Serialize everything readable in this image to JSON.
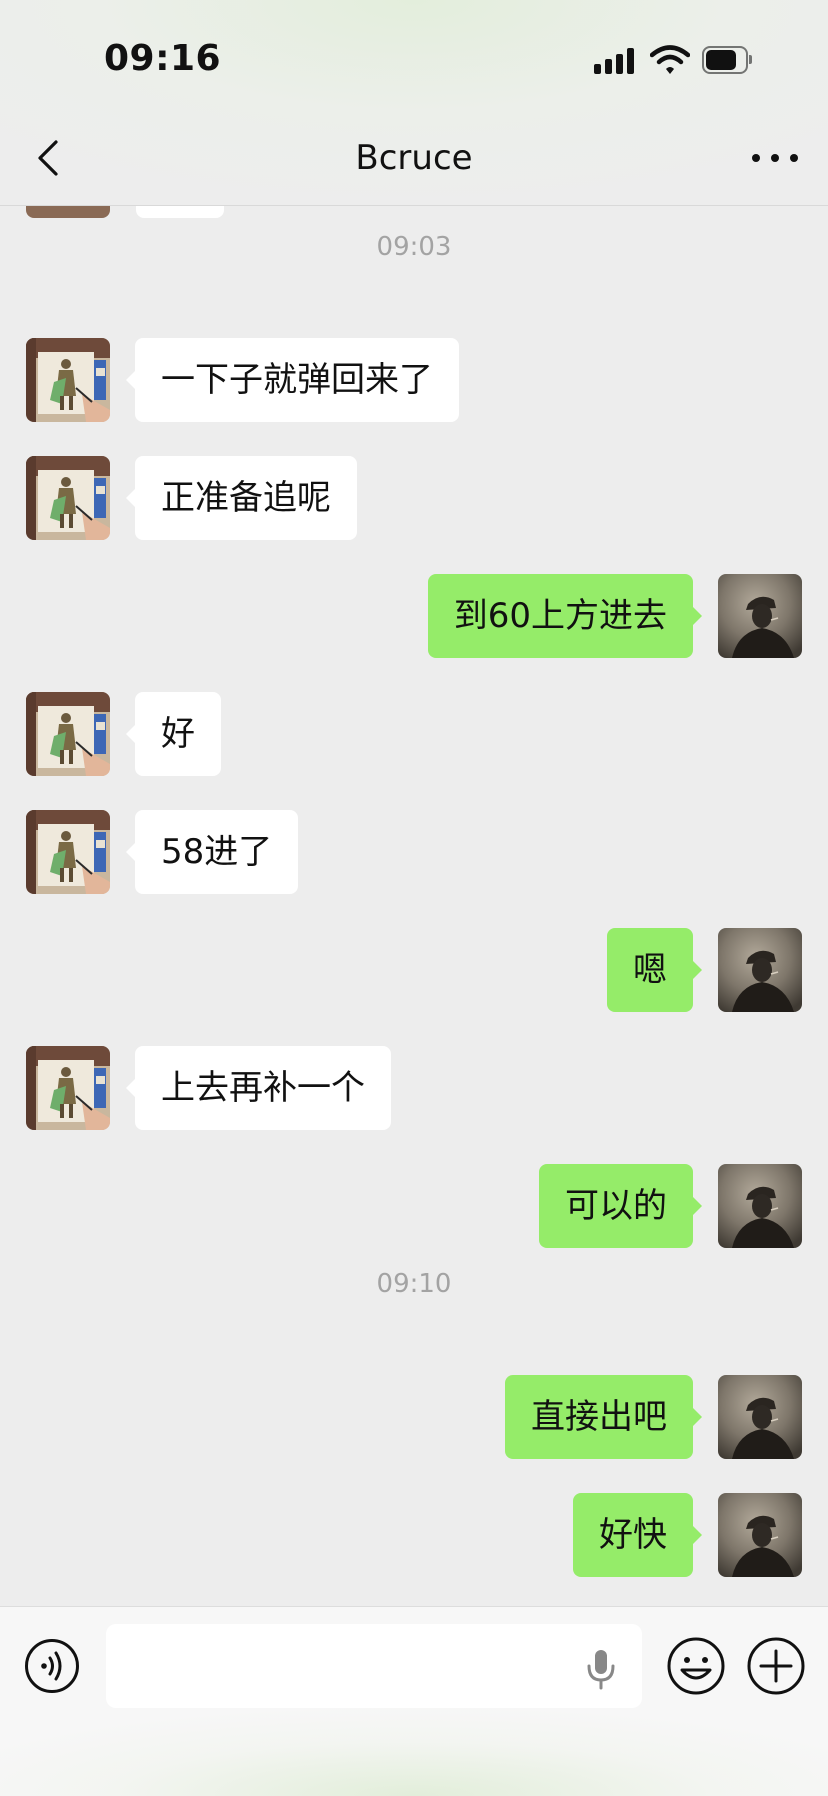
{
  "status_bar": {
    "time": "09:16",
    "icons": [
      "signal-icon",
      "wifi-icon",
      "battery-icon"
    ]
  },
  "nav": {
    "title": "Bcruce",
    "left_icon": "back-chevron-icon",
    "right_icon": "more-dots-icon"
  },
  "colors": {
    "sent_bubble": "#95EC69",
    "received_bubble": "#FFFFFF",
    "background": "#EDEDED",
    "timestamp": "#A3A3A3"
  },
  "messages": {
    "ts1": "09:03",
    "m1": "一下子就弹回来了",
    "m2": "正准备追呢",
    "m3": "到60上方进去",
    "m4": "好",
    "m5": "58进了",
    "m6": "嗯",
    "m7": "上去再补一个",
    "m8": "可以的",
    "ts2": "09:10",
    "m9": "直接出吧",
    "m10": "好快"
  },
  "input_bar": {
    "text": "",
    "icons": [
      "voice-icon",
      "microphone-icon",
      "emoji-icon",
      "plus-icon"
    ]
  }
}
